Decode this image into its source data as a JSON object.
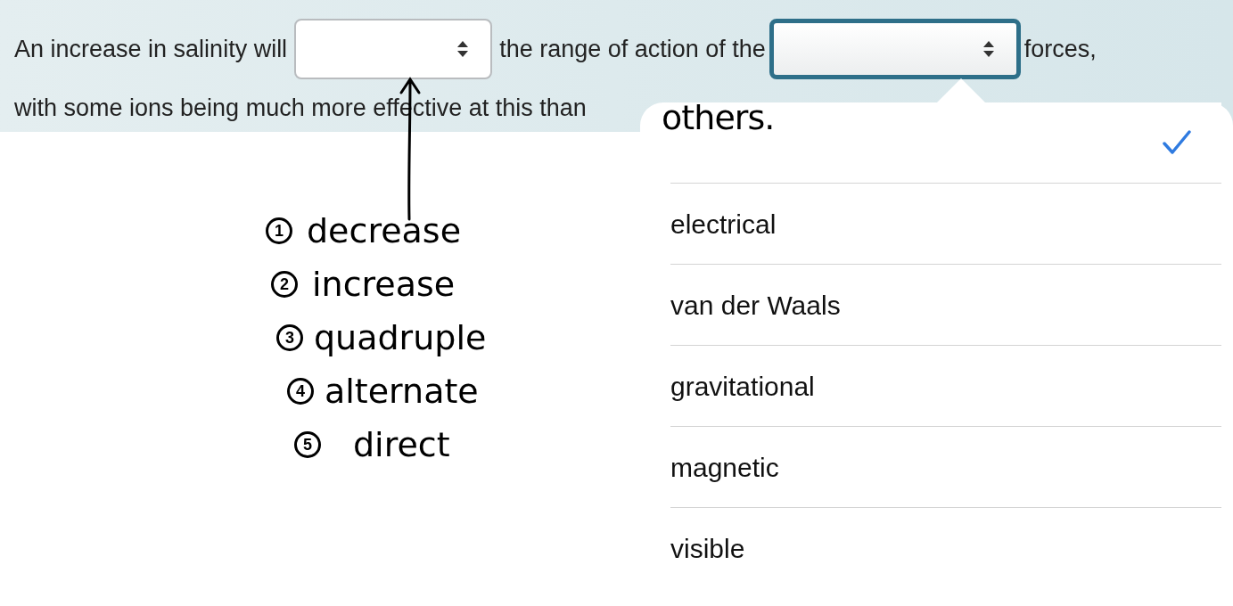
{
  "sentence": {
    "part_1": "An increase in salinity will",
    "part_2": "the range of action of the",
    "part_3": "forces,",
    "line_2": "with some ions being much more effective at this than"
  },
  "selects": [
    {
      "focused": false
    },
    {
      "focused": true
    }
  ],
  "dropdown": {
    "options": [
      {
        "selected": true
      },
      {
        "label": "electrical",
        "selected": false
      },
      {
        "label": "van der Waals",
        "selected": false
      },
      {
        "label": "gravitational",
        "selected": false
      },
      {
        "label": "magnetic",
        "selected": false
      },
      {
        "label": "visible",
        "selected": false
      }
    ]
  },
  "annotations": {
    "handwritten_word": "others.",
    "list": [
      {
        "number": "1",
        "word": "decrease"
      },
      {
        "number": "2",
        "word": "increase"
      },
      {
        "number": "3",
        "word": "quadruple"
      },
      {
        "number": "4",
        "word": "alternate"
      },
      {
        "number": "5",
        "word": "direct"
      }
    ]
  }
}
